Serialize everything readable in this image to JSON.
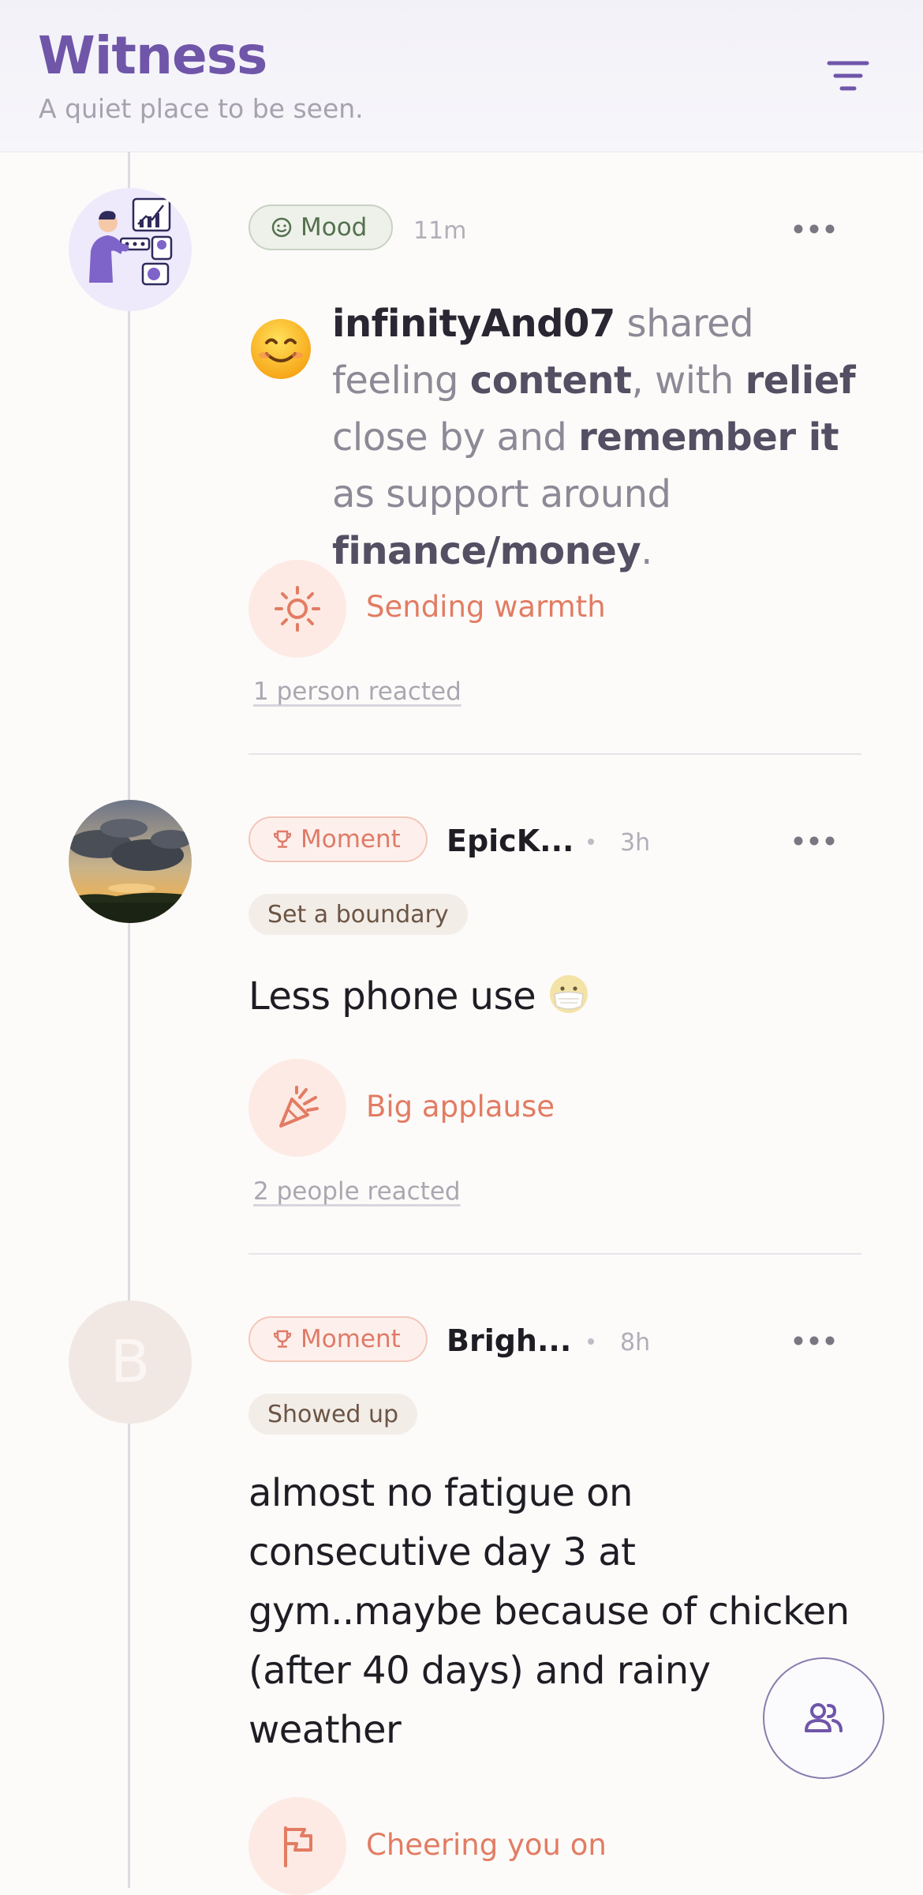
{
  "header": {
    "title": "Witness",
    "subtitle": "A quiet place to be seen.",
    "filter_icon": "filter-lines-icon"
  },
  "posts": [
    {
      "type_label": "Mood",
      "type_icon": "smile-icon",
      "time": "11m",
      "avatar": "illustration-avatar",
      "emoji": "smiling-face",
      "feeling": {
        "user": "infinityAnd07",
        "t1": " shared feeling ",
        "feeling": "content",
        "t2": ", with ",
        "secondary": "relief",
        "t3": " close by and ",
        "action": "remember it",
        "t4": " as support around ",
        "topic": "finance/money",
        "t5": "."
      },
      "reaction": {
        "label": "Sending warmth",
        "icon": "sun-icon",
        "count_text": "1 person reacted"
      }
    },
    {
      "type_label": "Moment",
      "type_icon": "trophy-icon",
      "author": "EpicK...",
      "time": "3h",
      "avatar": "sunset-photo-avatar",
      "tag": "Set a boundary",
      "text": "Less phone use",
      "text_emoji": "face-with-medical-mask",
      "reaction": {
        "label": "Big applause",
        "icon": "party-popper-icon",
        "count_text": "2 people reacted"
      }
    },
    {
      "type_label": "Moment",
      "type_icon": "trophy-icon",
      "author": "Brigh...",
      "time": "8h",
      "avatar_letter": "B",
      "tag": "Showed up",
      "text_lines": [
        "almost no fatigue on",
        "consecutive day 3 at",
        "gym..maybe because of chicken",
        "(after 40 days) and rainy",
        "weather"
      ],
      "reaction": {
        "label": "Cheering you on",
        "icon": "flag-icon"
      }
    }
  ],
  "fab_icon": "people-icon",
  "colors": {
    "accent": "#6f56a9",
    "reaction": "#e27c63",
    "mood_green": "#55704f"
  }
}
